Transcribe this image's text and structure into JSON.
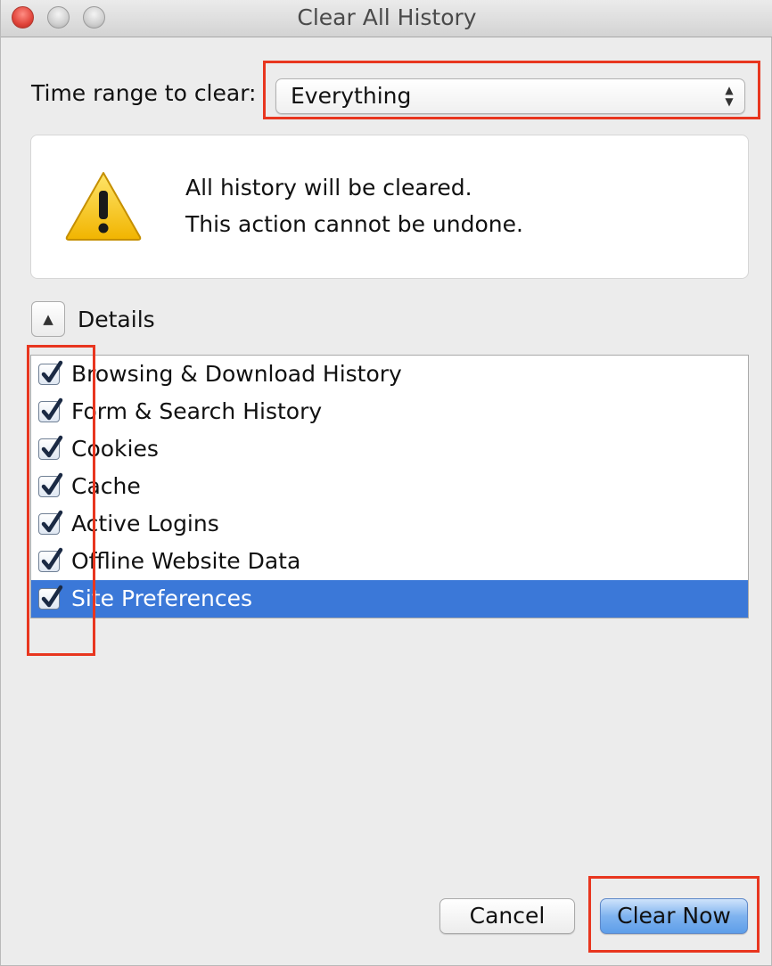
{
  "window": {
    "title": "Clear All History"
  },
  "time_range": {
    "label": "Time range to clear:",
    "selected": "Everything"
  },
  "warning": {
    "line1": "All history will be cleared.",
    "line2": "This action cannot be undone.",
    "icon": "warning-triangle-icon"
  },
  "details": {
    "label": "Details",
    "toggle_icon": "disclosure-triangle-up-icon"
  },
  "items": [
    {
      "label": "Browsing & Download History",
      "checked": true
    },
    {
      "label": "Form & Search History",
      "checked": true
    },
    {
      "label": "Cookies",
      "checked": true
    },
    {
      "label": "Cache",
      "checked": true
    },
    {
      "label": "Active Logins",
      "checked": true
    },
    {
      "label": "Offline Website Data",
      "checked": true
    },
    {
      "label": "Site Preferences",
      "checked": true,
      "selected": true
    }
  ],
  "buttons": {
    "cancel": "Cancel",
    "clear_now": "Clear Now"
  },
  "colors": {
    "highlight_box": "#e8361f",
    "selection": "#3b78d8"
  }
}
